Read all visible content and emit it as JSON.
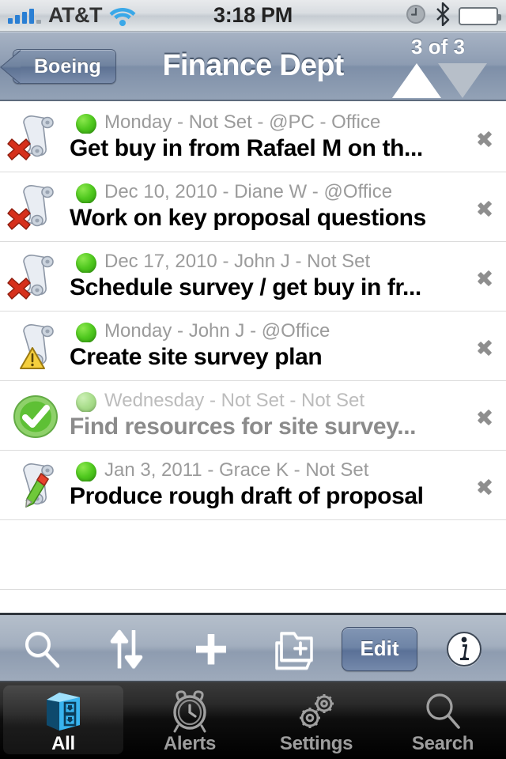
{
  "status_bar": {
    "carrier": "AT&T",
    "time": "3:18 PM",
    "signal_icon": "signal-bars-icon",
    "wifi_icon": "wifi-icon",
    "alarm_icon": "alarm-clock-icon",
    "bluetooth_icon": "bluetooth-icon",
    "battery_icon": "battery-icon"
  },
  "nav_bar": {
    "back_label": "Boeing",
    "title": "Finance Dept",
    "pager_label": "3 of 3",
    "up_arrow_icon": "triangle-up-icon",
    "down_arrow_icon": "triangle-down-icon"
  },
  "list": {
    "rows": [
      {
        "icon": "scroll-document-icon",
        "badge": "red-x-icon",
        "subtitle": "Monday - Not Set - @PC - Office",
        "title": "Get buy in from Rafael M on th...",
        "status_dot": "green-dot-icon",
        "completed": false,
        "disclosure_icon": "chevron-right-icon"
      },
      {
        "icon": "scroll-document-icon",
        "badge": "red-x-icon",
        "subtitle": "Dec 10, 2010 - Diane W - @Office",
        "title": "Work on key proposal questions",
        "status_dot": "green-dot-icon",
        "completed": false,
        "disclosure_icon": "chevron-right-icon"
      },
      {
        "icon": "scroll-document-icon",
        "badge": "red-x-icon",
        "subtitle": "Dec 17, 2010 - John J - Not Set",
        "title": "Schedule survey / get buy in fr...",
        "status_dot": "green-dot-icon",
        "completed": false,
        "disclosure_icon": "chevron-right-icon"
      },
      {
        "icon": "scroll-document-icon",
        "badge": "yellow-warning-triangle-icon",
        "subtitle": "Monday - John J - @Office",
        "title": "Create site survey plan",
        "status_dot": "green-dot-icon",
        "completed": false,
        "disclosure_icon": "chevron-right-icon"
      },
      {
        "icon": "green-check-circle-icon",
        "badge": "none",
        "subtitle": "Wednesday - Not Set - Not Set",
        "title": "Find resources for site survey...",
        "status_dot": "green-dot-icon",
        "completed": true,
        "disclosure_icon": "chevron-right-icon"
      },
      {
        "icon": "scroll-document-icon",
        "badge": "green-pencil-icon",
        "subtitle": "Jan 3, 2011 - Grace K - Not Set",
        "title": "Produce rough draft of proposal",
        "status_dot": "green-dot-icon",
        "completed": false,
        "disclosure_icon": "chevron-right-icon"
      }
    ]
  },
  "toolbar": {
    "items": [
      {
        "icon": "search-icon",
        "label": ""
      },
      {
        "icon": "sort-up-down-arrows-icon",
        "label": ""
      },
      {
        "icon": "plus-icon",
        "label": ""
      },
      {
        "icon": "new-folder-icon",
        "label": ""
      }
    ],
    "edit_label": "Edit",
    "info_icon": "info-circle-icon"
  },
  "tab_bar": {
    "tabs": [
      {
        "label": "All",
        "icon": "box-cube-icon",
        "active": true
      },
      {
        "label": "Alerts",
        "icon": "alarm-clock-icon",
        "active": false
      },
      {
        "label": "Settings",
        "icon": "gears-icon",
        "active": false
      },
      {
        "label": "Search",
        "icon": "magnifier-icon",
        "active": false
      }
    ]
  },
  "colors": {
    "accent_blue": "#5d7293",
    "nav_bar": "#8d9cb2",
    "status_green": "#4fc81e",
    "badge_red": "#d6301c",
    "badge_yellow": "#f0c419",
    "tab_active_blue": "#39b4ef"
  }
}
